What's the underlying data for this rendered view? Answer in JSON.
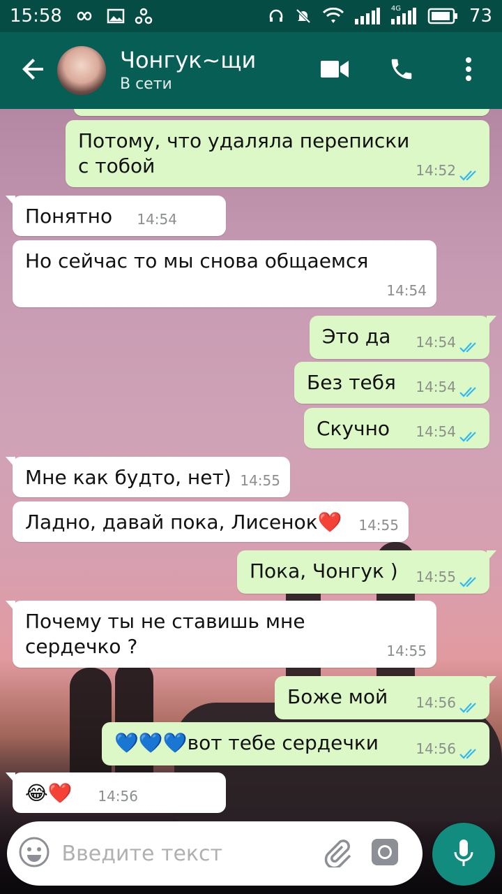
{
  "status_bar": {
    "time": "15:58",
    "network": "4G",
    "battery": "73",
    "icons": [
      "infinity-icon",
      "image-icon",
      "network-share-icon",
      "headset-icon",
      "mute-icon",
      "wifi-icon",
      "signal-icon",
      "signal-4g-icon",
      "battery-icon"
    ]
  },
  "header": {
    "contact_name": "Чонгук~щи",
    "contact_status": "В сети",
    "icons": [
      "back-arrow-icon",
      "video-call-icon",
      "phone-call-icon",
      "more-menu-icon"
    ]
  },
  "messages": [
    {
      "dir": "out",
      "text": "Потому, что удаляла переписки с тобой",
      "time": "14:52",
      "read": true
    },
    {
      "dir": "in",
      "text": "Понятно",
      "time": "14:54"
    },
    {
      "dir": "in",
      "text": "Но сейчас то мы снова общаемся",
      "time": "14:54"
    },
    {
      "dir": "out",
      "text": "Это да",
      "time": "14:54",
      "read": true
    },
    {
      "dir": "out",
      "text": "Без тебя",
      "time": "14:54",
      "read": true
    },
    {
      "dir": "out",
      "text": "Скучно",
      "time": "14:54",
      "read": true
    },
    {
      "dir": "in",
      "text": "Мне как будто, нет)",
      "time": "14:55"
    },
    {
      "dir": "in",
      "text": "Ладно, давай пока, Лисенок❤️",
      "time": "14:55"
    },
    {
      "dir": "out",
      "text": "Пока, Чонгук )",
      "time": "14:55",
      "read": true
    },
    {
      "dir": "in",
      "text": "Почему ты не ставишь мне сердечко ?",
      "time": "14:55"
    },
    {
      "dir": "out",
      "text": "Боже мой",
      "time": "14:56",
      "read": true
    },
    {
      "dir": "out",
      "text": "💙💙💙вот тебе сердечки",
      "time": "14:56",
      "read": true
    },
    {
      "dir": "in",
      "text": "😂❤️",
      "time": "14:56"
    }
  ],
  "input": {
    "placeholder": "Введите текст",
    "icons": [
      "emoji-icon",
      "attach-icon",
      "camera-icon",
      "mic-icon"
    ]
  },
  "colors": {
    "header_bg": "#075e54",
    "status_bg": "#054d44",
    "bubble_out": "#dcf8c6",
    "bubble_in": "#ffffff",
    "read_ticks": "#34b7f1",
    "fab": "#128c7e"
  }
}
